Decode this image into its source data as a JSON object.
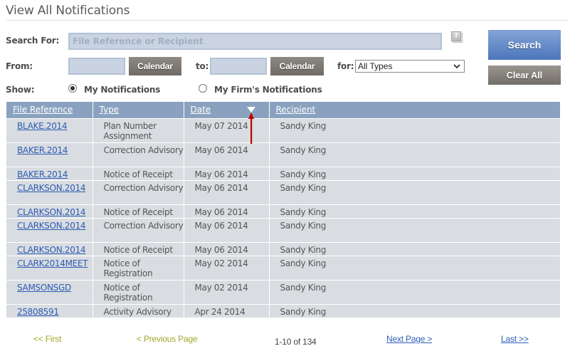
{
  "page": {
    "title": "View All Notifications"
  },
  "search": {
    "search_for_label": "Search For:",
    "search_value": "",
    "search_placeholder": "File Reference or Recipient",
    "help_icon_glyph": "?",
    "from_label": "From:",
    "from_value": "",
    "calendar_label": "Calendar",
    "to_label": "to:",
    "to_value": "",
    "for_label": "for:",
    "type_selected": "All Types",
    "search_button": "Search",
    "clear_button": "Clear All",
    "show_label": "Show:",
    "show_options": [
      {
        "label": "My Notifications",
        "checked": true
      },
      {
        "label": "My Firm's Notifications",
        "checked": false
      }
    ]
  },
  "table": {
    "columns": [
      "File Reference",
      "Type",
      "Date",
      "Recipient"
    ],
    "sort_column": "Date",
    "sort_direction": "descending",
    "rows": [
      {
        "ref": "BLAKE.2014",
        "type": "Plan Number Assignment",
        "date": "May 07 2014",
        "recipient": "Sandy King"
      },
      {
        "ref": "BAKER.2014",
        "type": "Correction Advisory",
        "date": "May 06 2014",
        "recipient": "Sandy King"
      },
      {
        "ref": "BAKER.2014",
        "type": "Notice of Receipt",
        "date": "May 06 2014",
        "recipient": "Sandy King"
      },
      {
        "ref": "CLARKSON.2014",
        "type": "Correction Advisory",
        "date": "May 06 2014",
        "recipient": "Sandy King"
      },
      {
        "ref": "CLARKSON.2014",
        "type": "Notice of Receipt",
        "date": "May 06 2014",
        "recipient": "Sandy King"
      },
      {
        "ref": "CLARKSON.2014",
        "type": "Correction Advisory",
        "date": "May 06 2014",
        "recipient": "Sandy King"
      },
      {
        "ref": "CLARKSON.2014",
        "type": "Notice of Receipt",
        "date": "May 06 2014",
        "recipient": "Sandy King"
      },
      {
        "ref": "CLARK2014MEET",
        "type": "Notice of Registration",
        "date": "May 02 2014",
        "recipient": "Sandy King"
      },
      {
        "ref": "SAMSONSGD",
        "type": "Notice of Registration",
        "date": "May 02 2014",
        "recipient": "Sandy King"
      },
      {
        "ref": "25808591",
        "type": "Activity Advisory",
        "date": "Apr 24 2014",
        "recipient": "Sandy King"
      }
    ]
  },
  "pager": {
    "first": "<< First",
    "previous": "< Previous Page",
    "info": "1-10 of 134",
    "next": "Next Page >",
    "last": "Last >>"
  },
  "colors": {
    "header_bg": "#8aa2bf",
    "row_bg": "#d9dce0",
    "link": "#2d5db5",
    "search_button": "#4c76bc",
    "annotation_arrow": "#c00000"
  }
}
